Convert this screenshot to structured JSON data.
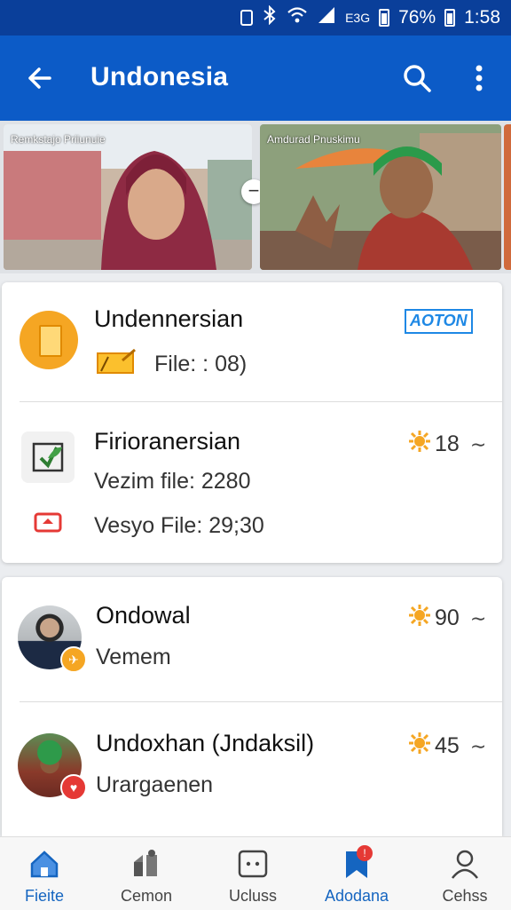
{
  "status_bar": {
    "signal_text": "E3G",
    "battery": "76%",
    "time": "1:58"
  },
  "app_bar": {
    "title": "Undonesia",
    "back_icon": "arrow-left-icon",
    "search_icon": "search-icon",
    "more_icon": "more-vertical-icon"
  },
  "videos": [
    {
      "caption": "Remkstajo Priiunuie"
    },
    {
      "caption": "Amdurad Pnuskimu"
    }
  ],
  "card1": {
    "item1": {
      "title": "Undennersian",
      "file_line": "File: : 08)",
      "badge": "AOTON"
    },
    "item2": {
      "title": "Firioranersian",
      "count": "18",
      "line1": "Vezim file: 2280",
      "line2": "Vesyo File: 29;30"
    }
  },
  "card2": {
    "item1": {
      "title": "Ondowal",
      "subtitle": "Vemem",
      "count": "90"
    },
    "item2": {
      "title": "Undoxhan (Jndaksil)",
      "subtitle": "Urargaenen",
      "count": "45"
    }
  },
  "bottom_nav": [
    {
      "label": "Fieite",
      "icon": "home-icon",
      "active": true
    },
    {
      "label": "Cemon",
      "icon": "community-icon",
      "active": false
    },
    {
      "label": "Ucluss",
      "icon": "chat-box-icon",
      "active": false
    },
    {
      "label": "Adodana",
      "icon": "bookmark-icon",
      "active": true
    },
    {
      "label": "Cehss",
      "icon": "person-icon",
      "active": false
    }
  ],
  "colors": {
    "app_bar": "#0c5bc7",
    "status_bar": "#0a3f9a",
    "accent": "#1565c0",
    "badge_red": "#e53935",
    "gold": "#f5a623"
  }
}
